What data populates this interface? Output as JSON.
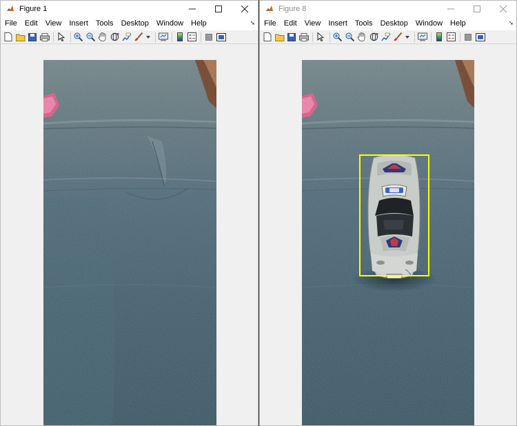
{
  "windows": [
    {
      "title": "Figure 1",
      "active": true,
      "menu": [
        "File",
        "Edit",
        "View",
        "Insert",
        "Tools",
        "Desktop",
        "Window",
        "Help"
      ]
    },
    {
      "title": "Figure 8",
      "active": false,
      "menu": [
        "File",
        "Edit",
        "View",
        "Insert",
        "Tools",
        "Desktop",
        "Window",
        "Help"
      ],
      "annotation_color": "#ffff00"
    }
  ],
  "toolbar_icons": [
    "new-figure-icon",
    "open-file-icon",
    "save-icon",
    "print-icon",
    "pointer-icon",
    "zoom-in-icon",
    "zoom-out-icon",
    "pan-icon",
    "rotate-3d-icon",
    "data-cursor-icon",
    "brush-icon",
    "link-plot-icon",
    "colorbar-icon",
    "legend-icon",
    "hide-plot-tools-icon",
    "show-plot-tools-icon"
  ],
  "colors": {
    "fabric": "#3e5864",
    "detection_box": "#ffff00",
    "toolbar_bg": "#f0f0f0"
  }
}
